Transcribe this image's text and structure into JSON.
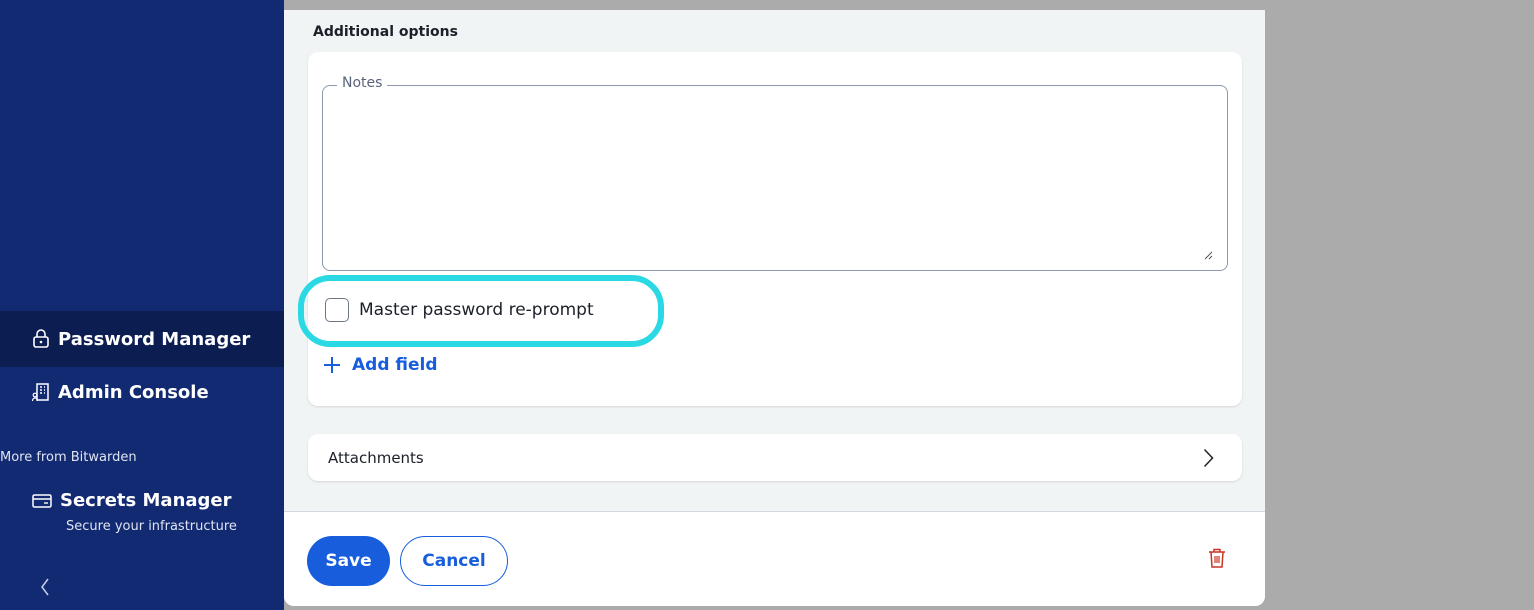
{
  "sidebar": {
    "password_manager": "Password Manager",
    "admin_console": "Admin Console",
    "more_from": "More from Bitwarden",
    "secrets_manager": "Secrets Manager",
    "secrets_tagline": "Secure your infrastructure"
  },
  "dialog": {
    "section_title": "Additional options",
    "notes_label": "Notes",
    "notes_value": "",
    "reprompt_label": "Master password re-prompt",
    "reprompt_checked": false,
    "add_field_label": "Add field",
    "attachments_label": "Attachments",
    "save_label": "Save",
    "cancel_label": "Cancel"
  },
  "colors": {
    "sidebar_bg": "#122a72",
    "sidebar_active_bg": "#0c1d52",
    "primary": "#175ddc",
    "highlight": "#2ad9e3",
    "danger": "#c83522"
  },
  "icons": {
    "password_manager": "lock-icon",
    "admin_console": "building-icon",
    "secrets_manager": "window-icon",
    "collapse": "chevron-left-icon",
    "add_field": "plus-icon",
    "attachments": "chevron-right-icon",
    "delete": "trash-icon"
  }
}
